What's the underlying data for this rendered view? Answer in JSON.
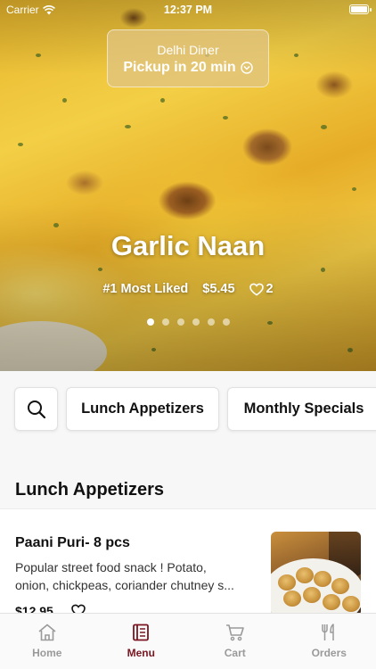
{
  "status_bar": {
    "carrier": "Carrier",
    "time": "12:37 PM"
  },
  "pickup": {
    "restaurant": "Delhi Diner",
    "label": "Pickup in 20 min"
  },
  "featured": {
    "name": "Garlic Naan",
    "badge": "#1 Most Liked",
    "price": "$5.45",
    "likes": "2",
    "slides": 6,
    "active_slide": 1
  },
  "filters": {
    "categories": [
      "Lunch Appetizers",
      "Monthly Specials"
    ]
  },
  "section": {
    "title": "Lunch Appetizers"
  },
  "items": [
    {
      "name": "Paani Puri- 8 pcs",
      "description_line1": "Popular street food snack ! Potato,",
      "description_line2": "onion, chickpeas, coriander chutney s...",
      "price": "$12.95"
    }
  ],
  "tabs": [
    {
      "label": "Home",
      "icon": "home-icon"
    },
    {
      "label": "Menu",
      "icon": "menu-book-icon"
    },
    {
      "label": "Cart",
      "icon": "cart-icon"
    },
    {
      "label": "Orders",
      "icon": "utensils-icon"
    }
  ],
  "active_tab": "Menu",
  "colors": {
    "accent": "#7a1520",
    "tab_inactive": "#9a9a9a",
    "hero_text": "#ffffff"
  }
}
